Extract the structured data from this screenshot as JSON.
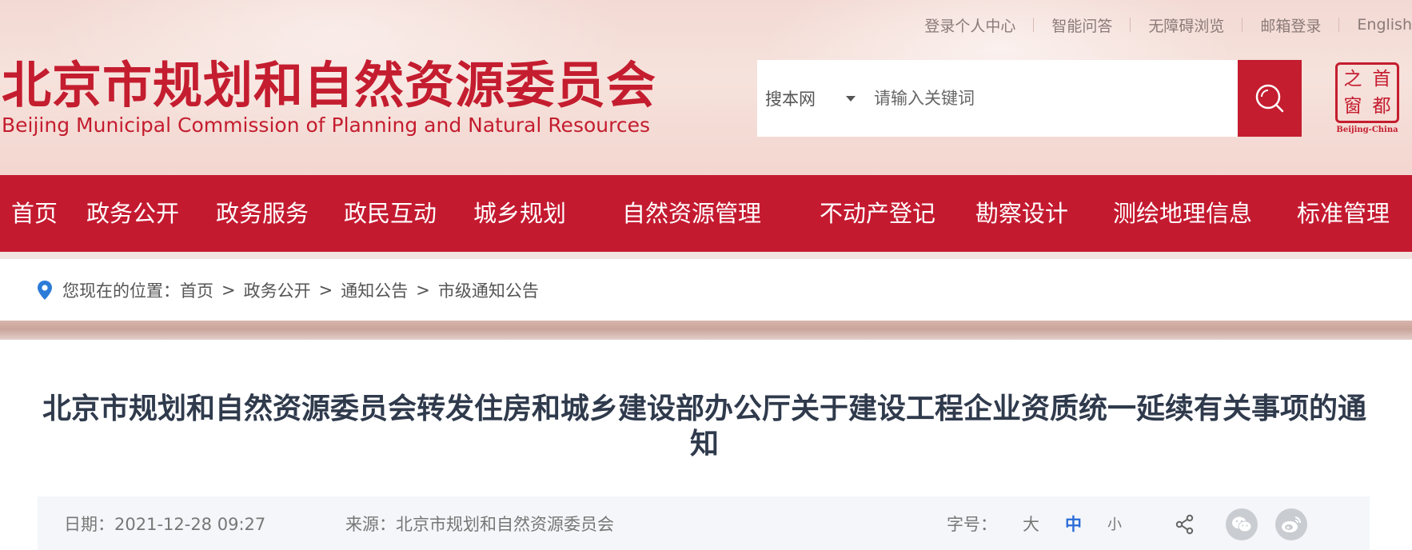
{
  "top_links": [
    "登录个人中心",
    "智能问答",
    "无障碍浏览",
    "邮箱登录",
    "English"
  ],
  "site": {
    "title": "北京市规划和自然资源委员会",
    "subtitle": "Beijing Municipal Commission of Planning and Natural Resources"
  },
  "search": {
    "scope": "搜本网",
    "placeholder": "请输入关键词",
    "icon": "search-icon"
  },
  "capital_logo": {
    "chars": [
      "之",
      "首",
      "窗",
      "都"
    ],
    "caption": "Beijing-China"
  },
  "nav": [
    "首页",
    "政务公开",
    "政务服务",
    "政民互动",
    "城乡规划",
    "自然资源管理",
    "不动产登记",
    "勘察设计",
    "测绘地理信息",
    "标准管理"
  ],
  "breadcrumb": {
    "prefix": "您现在的位置：",
    "items": [
      "首页",
      "政务公开",
      "通知公告",
      "市级通知公告"
    ],
    "separator": ">"
  },
  "article": {
    "title": "北京市规划和自然资源委员会转发住房和城乡建设部办公厅关于建设工程企业资质统一延续有关事项的通知",
    "date": "日期：2021-12-28 09:27",
    "source": "来源：北京市规划和自然资源委员会",
    "font_size_label": "字号：",
    "font_sizes": [
      "大",
      "中",
      "小"
    ],
    "active_font_size": "中"
  },
  "colors": {
    "brand_red": "#c41d2f",
    "nav_red": "#c41a30",
    "active_blue": "#2b6cd8"
  }
}
